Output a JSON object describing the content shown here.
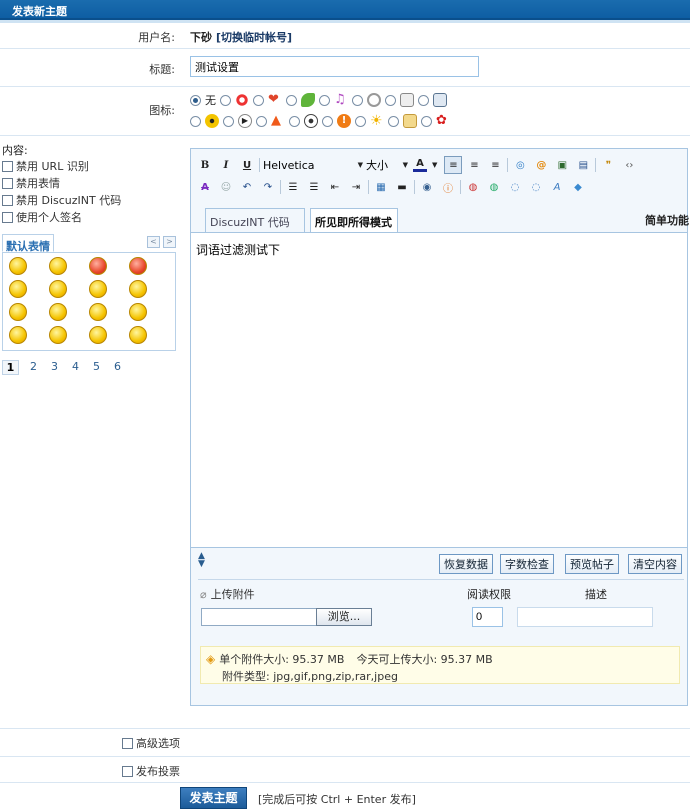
{
  "header": {
    "title": "发表新主题"
  },
  "form": {
    "username_label": "用户名:",
    "username_value": "下砂",
    "switch_account": "[切换临时帐号]",
    "subject_label": "标题:",
    "subject_value": "测试设置",
    "icon_label": "图标:",
    "icon_none": "无",
    "icons": [
      "target",
      "heart",
      "leaf",
      "music",
      "clip",
      "camera",
      "radiation",
      "play",
      "fire",
      "ball",
      "stop",
      "sun",
      "scroll",
      "rose"
    ],
    "content_label": "内容:"
  },
  "options": {
    "disable_url": "禁用 URL 识别",
    "disable_smiley": "禁用表情",
    "disable_code": "禁用 DiscuzINT 代码",
    "use_signature": "使用个人签名"
  },
  "smileys": {
    "tab": "默认表情",
    "prev": "<",
    "next": ">",
    "pages": [
      "1",
      "2",
      "3",
      "4",
      "5",
      "6"
    ]
  },
  "toolbar": {
    "bold": "B",
    "italic": "I",
    "underline": "U",
    "font_name": "Helvetica",
    "font_size": "大小",
    "font_color": "A"
  },
  "editor": {
    "tab_code": "DiscuzINT 代码模式",
    "tab_wysiwyg": "所见即所得模式",
    "simple": "简单功能",
    "content": "词语过滤测试下",
    "btn_restore": "恢复数据",
    "btn_count": "字数检查",
    "btn_preview": "预览帖子",
    "btn_clear": "清空内容"
  },
  "attachment": {
    "upload_label": "上传附件",
    "perm_label": "阅读权限",
    "desc_label": "描述",
    "browse": "浏览...",
    "perm_value": "0",
    "max_size": "单个附件大小: 95.37 MB",
    "today_size": "今天可上传大小: 95.37 MB",
    "types": "附件类型: jpg,gif,png,zip,rar,jpeg"
  },
  "footer": {
    "advanced": "高级选项",
    "poll": "发布投票",
    "submit": "发表主题",
    "hint": "[完成后可按 Ctrl + Enter 发布]"
  },
  "colors": {
    "brand": "#0e5ea3",
    "border": "#a7c5e1",
    "link": "#2a5d8f"
  }
}
